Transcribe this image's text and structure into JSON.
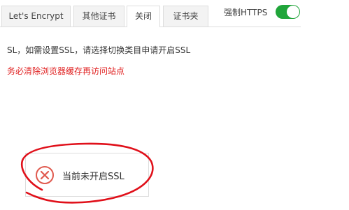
{
  "tabs": [
    {
      "label": "Let's Encrypt",
      "active": false
    },
    {
      "label": "其他证书",
      "active": false
    },
    {
      "label": "关闭",
      "active": true
    },
    {
      "label": "证书夹",
      "active": false
    }
  ],
  "force_https": {
    "label": "强制HTTPS",
    "enabled": true,
    "color": "#20a53a"
  },
  "info_text": "SL，如需设置SSL，请选择切换类目申请开启SSL",
  "warning_text": "务必清除浏览器缓存再访问站点",
  "warning_color": "#e02020",
  "status": {
    "icon": "close-circle-icon",
    "icon_color": "#e05a4f",
    "text": "当前未开启SSL"
  },
  "annotation_color": "#e0101a"
}
